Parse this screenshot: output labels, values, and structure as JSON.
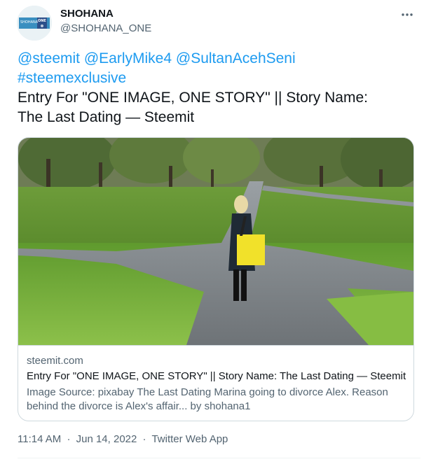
{
  "author": {
    "name": "SHOHANA",
    "handle": "@SHOHANA_ONE",
    "avatar_text_left": "SHOHANA",
    "avatar_text_right": "ONE"
  },
  "tweet": {
    "mentions": [
      "@steemit",
      "@EarlyMike4",
      "@SultanAcehSeni"
    ],
    "hashtag": "#steemexclusive",
    "body_line1": "Entry For \"ONE IMAGE, ONE STORY\" || Story Name:",
    "body_line2": "The Last Dating — Steemit"
  },
  "card": {
    "domain": "steemit.com",
    "title": "Entry For \"ONE IMAGE, ONE STORY\" || Story Name: The Last Dating — Steemit",
    "description": "Image Source: pixabay The Last Dating Marina going to divorce Alex. Reason behind the divorce is Alex's affair... by shohana1"
  },
  "meta": {
    "time": "11:14 AM",
    "separator": "·",
    "date": "Jun 14, 2022",
    "source": "Twitter Web App"
  },
  "icons": {
    "more": "more-horizontal-icon"
  },
  "colors": {
    "link": "#1d9bf0",
    "secondary_text": "#536471",
    "border": "#cfd9de"
  }
}
